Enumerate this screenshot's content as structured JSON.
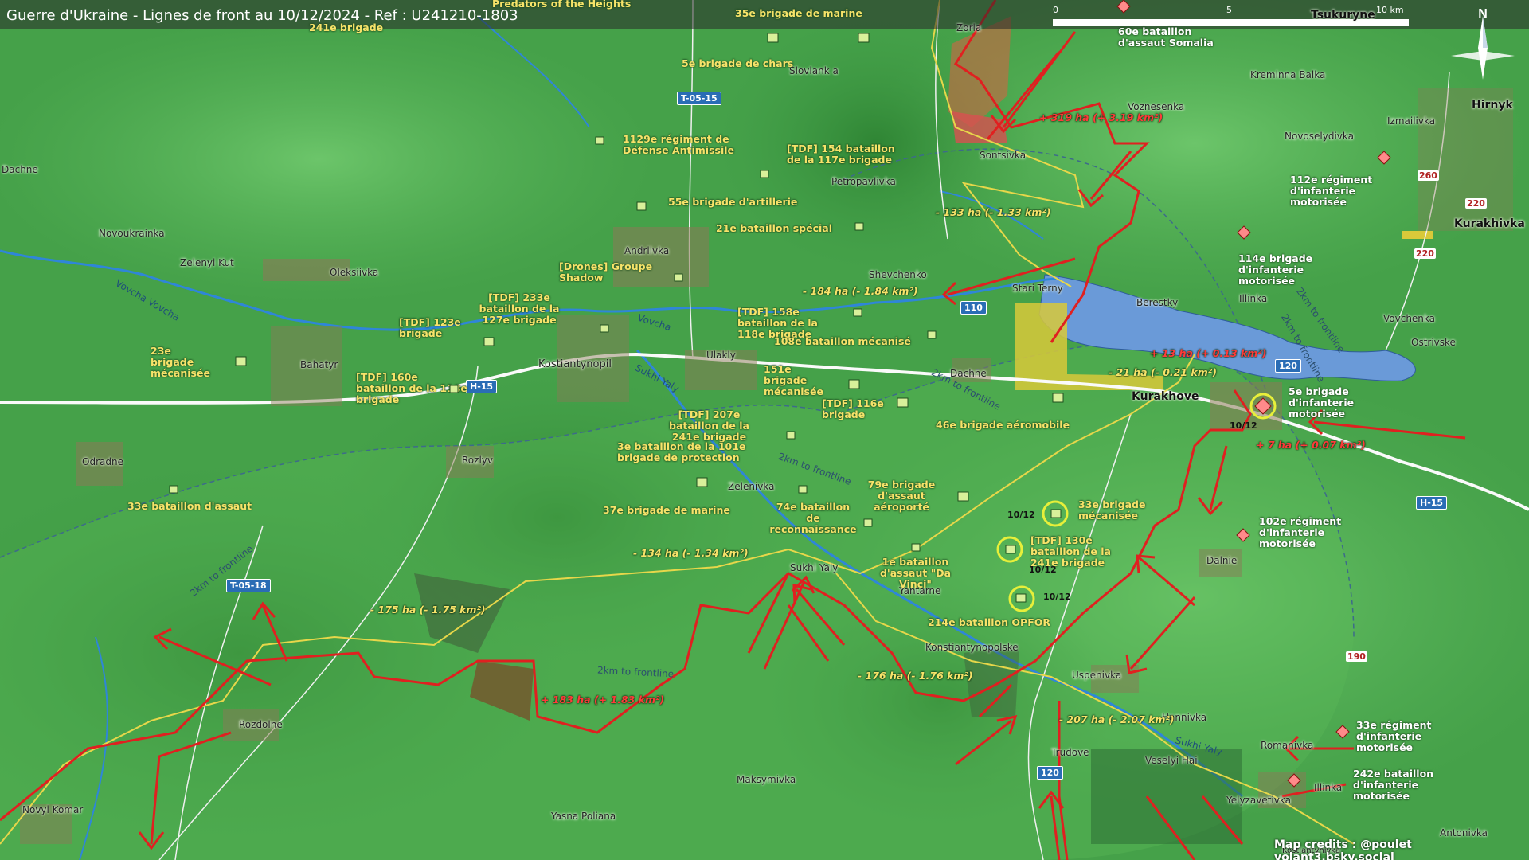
{
  "title": "Guerre d'Ukraine - Lignes de front au 10/12/2024 - Ref : U241210-1803",
  "scale": {
    "labels": [
      "0",
      "5",
      "10 km"
    ]
  },
  "compass": {
    "label": "N"
  },
  "credits": "Map credits : @poulet volant3.bsky.social",
  "towns": {
    "dachne_w": "Dachne",
    "novoukrainka": "Novoukrainka",
    "zelenyi_kut": "Zelenyi Kut",
    "oleksiivka": "Oleksiivka",
    "bahatyr": "Bahatyr",
    "andriivka": "Andriivka",
    "kostiantynopil": "Kostiantynopil",
    "odradne": "Odradne",
    "rozlyv": "Rozlyv",
    "sloviank": "Sloviank a",
    "petropavlivka": "Petropavlivka",
    "shevchenko": "Shevchenko",
    "sontsivka": "Sontsivka",
    "zoria": "Zoria",
    "ulakly": "Ulakly",
    "dachne_e": "Dachne",
    "stari_terny": "Stari Terny",
    "berestky": "Berestky",
    "kurakhove": "Kurakhove",
    "voznesenka": "Voznesenka",
    "kreminna_balka": "Kreminna Balka",
    "novoselydivka": "Novoselydivka",
    "izmailivka": "Izmailivka",
    "hirnyk": "Hirnyk",
    "kurakhivka": "Kurakhivka",
    "illinka_n": "Illinka",
    "vovchenka": "Vovchenka",
    "ostrivske": "Ostrivske",
    "tsukuryne": "Tsukuryne",
    "zelenivka": "Zelenivka",
    "sukhi_yaly": "Sukhi Yaly",
    "yantarne": "Yantarne",
    "dalnie": "Dalnie",
    "konstiantynopolske": "Konstiantynopolske",
    "uspenivka": "Uspenivka",
    "hannivka": "Hannivka",
    "trudove": "Trudove",
    "veselyi_hai": "Veselyi Hai",
    "romanivka": "Romanivka",
    "illinka_s": "Illinka",
    "yelyzavetivka": "Yelyzavetivka",
    "antonivka": "Antonivka",
    "rozdolne": "Rozdolne",
    "novyi_komar": "Novyi Komar",
    "maksymivka": "Maksymivka",
    "yasna_poliana": "Yasna Poliana",
    "kostiantynivka": "Kostiantynivka"
  },
  "rivers": {
    "vovcha_1": "Vovcha Vovcha",
    "vovcha_2": "Vovcha",
    "sukhi_yaly": "Sukhi Yaly",
    "sukhi_yaly_2": "Sukhi Yaly"
  },
  "roads": {
    "t0515": "T-05-15",
    "h15_w": "H-15",
    "h15_e": "H-15",
    "t0518": "T-05-18",
    "r110": "110",
    "r120_n": "120",
    "r120_s": "120",
    "r260": "260",
    "r220_a": "220",
    "r220_b": "220",
    "r190": "190"
  },
  "frontline_notes": {
    "a": "2km to frontline",
    "b": "2km to frontline",
    "c": "2km to frontline",
    "d": "2km to frontline",
    "e": "2km to frontline",
    "f": "2km to frontline"
  },
  "units": {
    "u241": "241e brigade",
    "u35marine": "35e brigade de marine",
    "u5chars": "5e brigade de chars",
    "u1129": "1129e régiment de Défense Antimissile",
    "u154": "[TDF] 154 bataillon de la 117e brigade",
    "u55art": "55e brigade d'artillerie",
    "u21spe": "21e bataillon spécial",
    "udrones": "[Drones] Groupe Shadow",
    "u233": "[TDF] 233e bataillon de la 127e brigade",
    "u123": "[TDF] 123e brigade",
    "u158": "[TDF] 158e bataillon de la 118e brigade",
    "u108": "108e bataillon mécanisé",
    "u23meca": "23e brigade mécanisée",
    "u160": "[TDF] 160e bataillon de la 118e brigade",
    "u151": "151e brigade mécanisée",
    "u116": "[TDF] 116e brigade",
    "u46": "46e brigade aéromobile",
    "u207": "[TDF] 207e bataillon de la 241e brigade",
    "u3bat": "3e bataillon de la 101e brigade de protection",
    "u33assaut": "33e bataillon d'assaut",
    "u37marine": "37e brigade de marine",
    "u74": "74e bataillon de reconnaissance",
    "u79": "79e brigade d'assaut aéroporté",
    "u33meca": "33e brigade mécanisée",
    "u130": "[TDF] 130e bataillon de la 241e brigade",
    "u1davinci": "1e bataillon d'assaut \"Da Vinci\"",
    "u214": "214e bataillon OPFOR",
    "u60somalia": "60e bataillon d'assaut Somalia",
    "r_predators": "Predators of the Heights",
    "r112": "112e régiment d'infanterie motorisée",
    "r114": "114e brigade d'infanterie motorisée",
    "r5": "5e brigade d'infanterie motorisée",
    "r102": "102e régiment d'infanterie motorisée",
    "r33": "33e régiment d'infanterie motorisée",
    "r242": "242e bataillon d'infanterie motorisée"
  },
  "area_changes": {
    "g319": "+ 319 ha (+ 3.19 km²)",
    "l133": "- 133 ha (- 1.33 km²)",
    "l184": "- 184 ha (- 1.84 km²)",
    "g13": "+ 13 ha (+ 0.13 km²)",
    "l21": "- 21 ha (- 0.21 km²)",
    "g7": "+ 7 ha (+ 0.07 km²)",
    "l134": "- 134 ha (- 1.34 km²)",
    "l175": "- 175 ha (- 1.75 km²)",
    "g183": "+ 183 ha (+ 1.83 km²)",
    "l176": "- 176 ha (- 1.76 km²)",
    "l207": "- 207 ha (- 2.07 km²)"
  },
  "dates": {
    "d1": "10/12",
    "d2": "10/12",
    "d3": "10/12",
    "d4": "10/12"
  },
  "colors": {
    "ukraine_unit": "#f7e36a",
    "russia": "#e02020",
    "water": "#6a9ad8",
    "front_ua": "#e7d74a",
    "front_ru": "#e02020"
  }
}
